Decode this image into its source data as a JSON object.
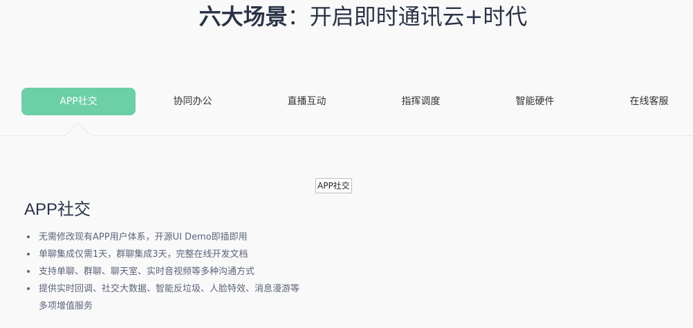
{
  "header": {
    "title_bold": "六大场景",
    "title_rest": "：开启即时通讯云+时代"
  },
  "tabs": [
    {
      "label": "APP社交",
      "active": true
    },
    {
      "label": "协同办公",
      "active": false
    },
    {
      "label": "直播互动",
      "active": false
    },
    {
      "label": "指挥调度",
      "active": false
    },
    {
      "label": "智能硬件",
      "active": false
    },
    {
      "label": "在线客服",
      "active": false
    }
  ],
  "content": {
    "image_alt": "APP社交",
    "section_title": "APP社交",
    "features": [
      "无需修改现有APP用户体系，开源UI Demo即插即用",
      "单聊集成仅需1天，群聊集成3天，完整在线开发文档",
      "支持单聊、群聊、聊天室、实时音视频等多种沟通方式",
      "提供实时回调、社交大数据、智能反垃圾、人脸特效、消息漫游等多项增值服务"
    ]
  },
  "colors": {
    "accent": "#6ccfa6",
    "title": "#2b3446",
    "body_text": "#5c6478",
    "background": "#f9f9fa"
  }
}
